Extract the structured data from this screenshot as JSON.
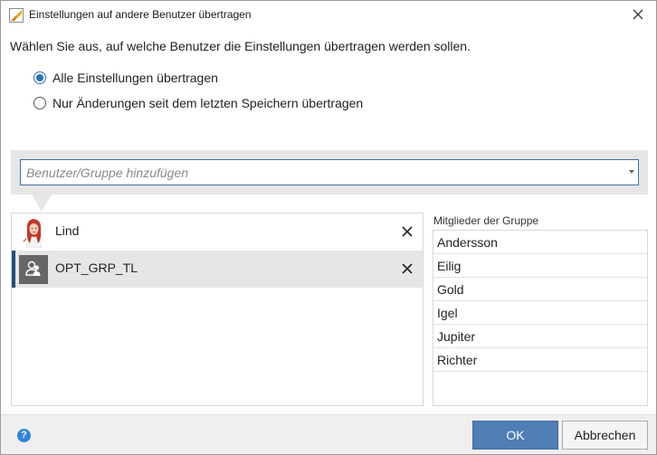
{
  "window": {
    "title": "Einstellungen auf andere Benutzer übertragen"
  },
  "instruction": "Wählen Sie aus, auf welche Benutzer die Einstellungen übertragen werden sollen.",
  "options": [
    {
      "label": "Alle Einstellungen übertragen",
      "checked": true
    },
    {
      "label": "Nur Änderungen seit dem letzten Speichern übertragen",
      "checked": false
    }
  ],
  "search": {
    "placeholder": "Benutzer/Gruppe hinzufügen",
    "value": ""
  },
  "selected_users": [
    {
      "name": "Lind",
      "kind": "user",
      "avatar": "user-photo-icon",
      "selected": false
    },
    {
      "name": "OPT_GRP_TL",
      "kind": "group",
      "avatar": "group-icon",
      "selected": true
    }
  ],
  "members": {
    "title": "Mitglieder der Gruppe",
    "items": [
      "Andersson",
      "Eilig",
      "Gold",
      "Igel",
      "Jupiter",
      "Richter"
    ]
  },
  "footer": {
    "help_symbol": "?",
    "ok_label": "OK",
    "cancel_label": "Abbrechen"
  },
  "colors": {
    "accent": "#2d6fb5",
    "ok_button": "#4f7fb5",
    "selection_bar": "#1f4e79",
    "band": "#e6e6e6"
  }
}
